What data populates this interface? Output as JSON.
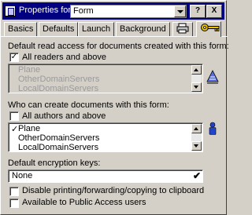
{
  "titlebar": {
    "label": "Properties for:",
    "selected": "Form",
    "help_label": "?",
    "close_label": "X"
  },
  "tabs": [
    {
      "label": "Basics"
    },
    {
      "label": "Defaults"
    },
    {
      "label": "Launch"
    },
    {
      "label": "Background"
    }
  ],
  "read_access": {
    "heading": "Default read access for documents created with this form:",
    "all_readers": {
      "label": "All readers and above",
      "checked_mark": "✓"
    },
    "items": [
      "Plane",
      "OtherDomainServers",
      "LocalDomainServers"
    ]
  },
  "create_access": {
    "heading": "Who can create documents with this form:",
    "all_authors": {
      "label": "All authors and above"
    },
    "items": [
      {
        "label": "Plane",
        "mark": "✓"
      },
      {
        "label": "OtherDomainServers",
        "mark": ""
      },
      {
        "label": "LocalDomainServers",
        "mark": ""
      }
    ]
  },
  "encryption": {
    "heading": "Default encryption keys:",
    "value": "None"
  },
  "options": {
    "disable_printing": "Disable printing/forwarding/copying to clipboard",
    "public_access": "Available to Public Access users"
  },
  "colors": {
    "titlebar": "#000080",
    "face": "#d4d0c8",
    "disabled_text": "#9a9a9a",
    "person_icon": "#2244cc"
  }
}
